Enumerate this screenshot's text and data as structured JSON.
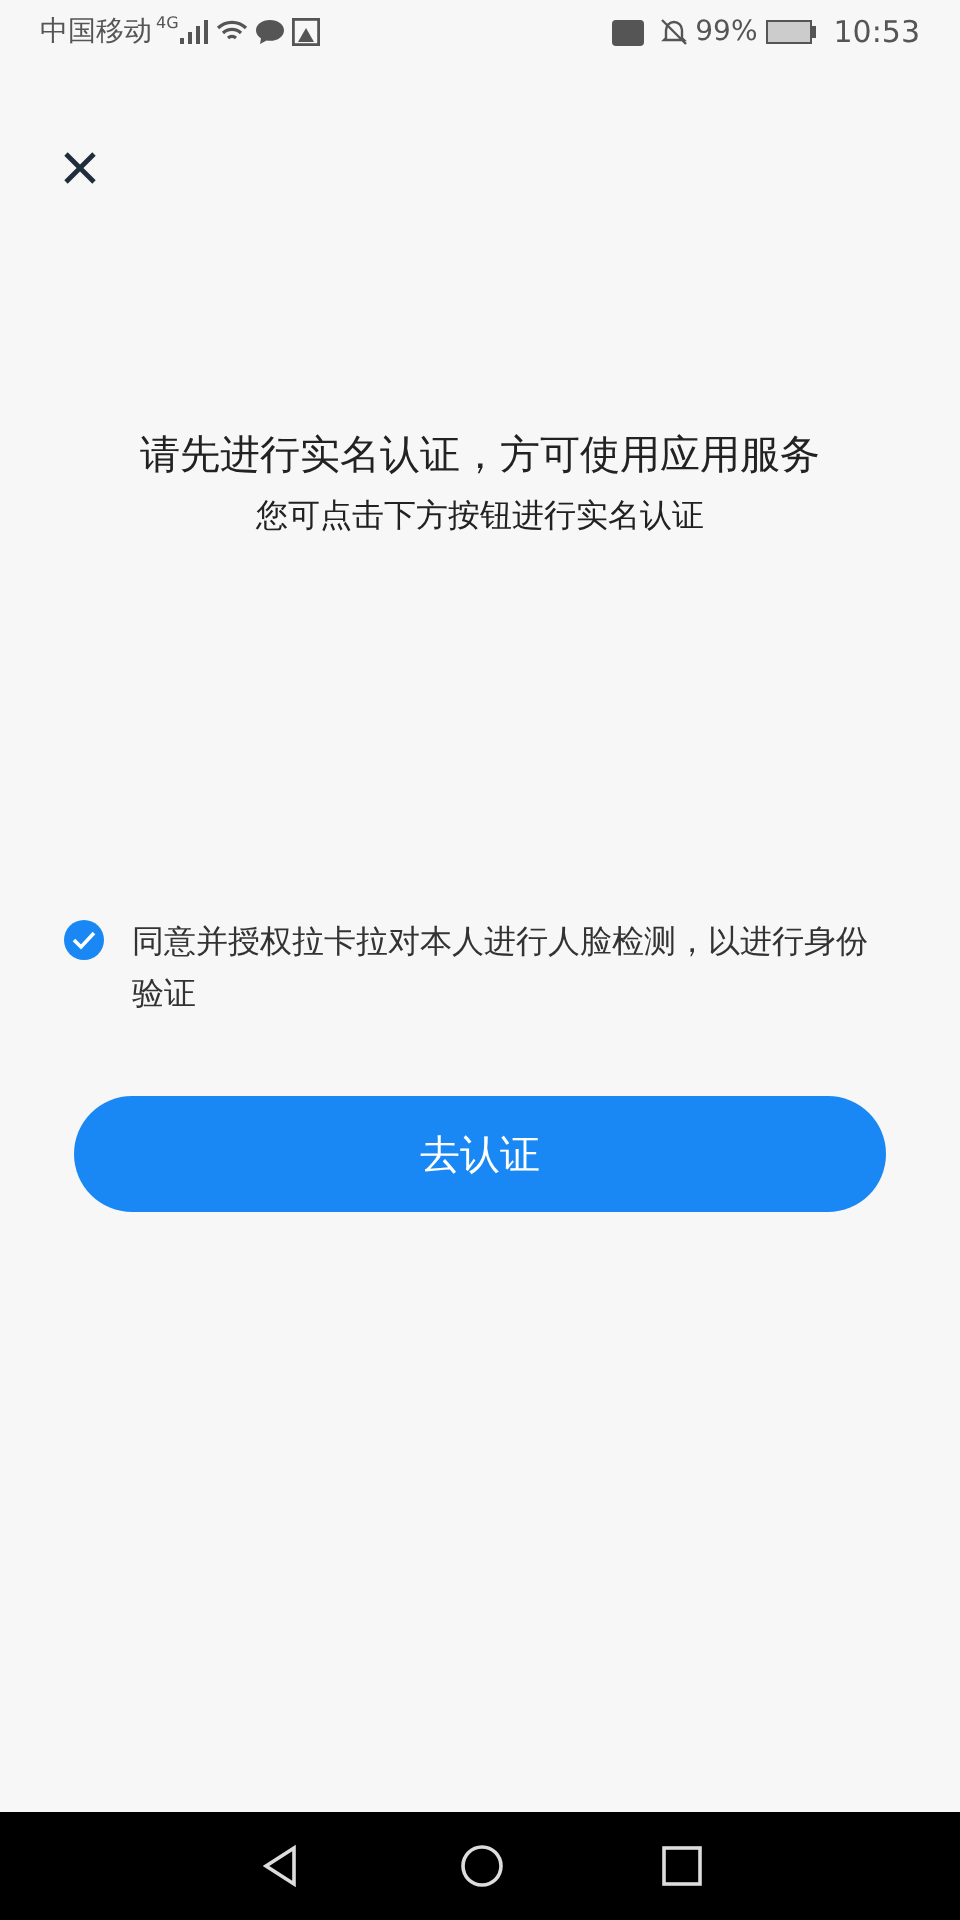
{
  "status_bar": {
    "carrier": "中国移动",
    "network": "4G",
    "battery_percent": "99%",
    "time": "10:53"
  },
  "title": "请先进行实名认证，方可使用应用服务",
  "subtitle": "您可点击下方按钮进行实名认证",
  "agreement": {
    "checked": true,
    "text": "同意并授权拉卡拉对本人进行人脸检测，以进行身份验证"
  },
  "button": "去认证"
}
